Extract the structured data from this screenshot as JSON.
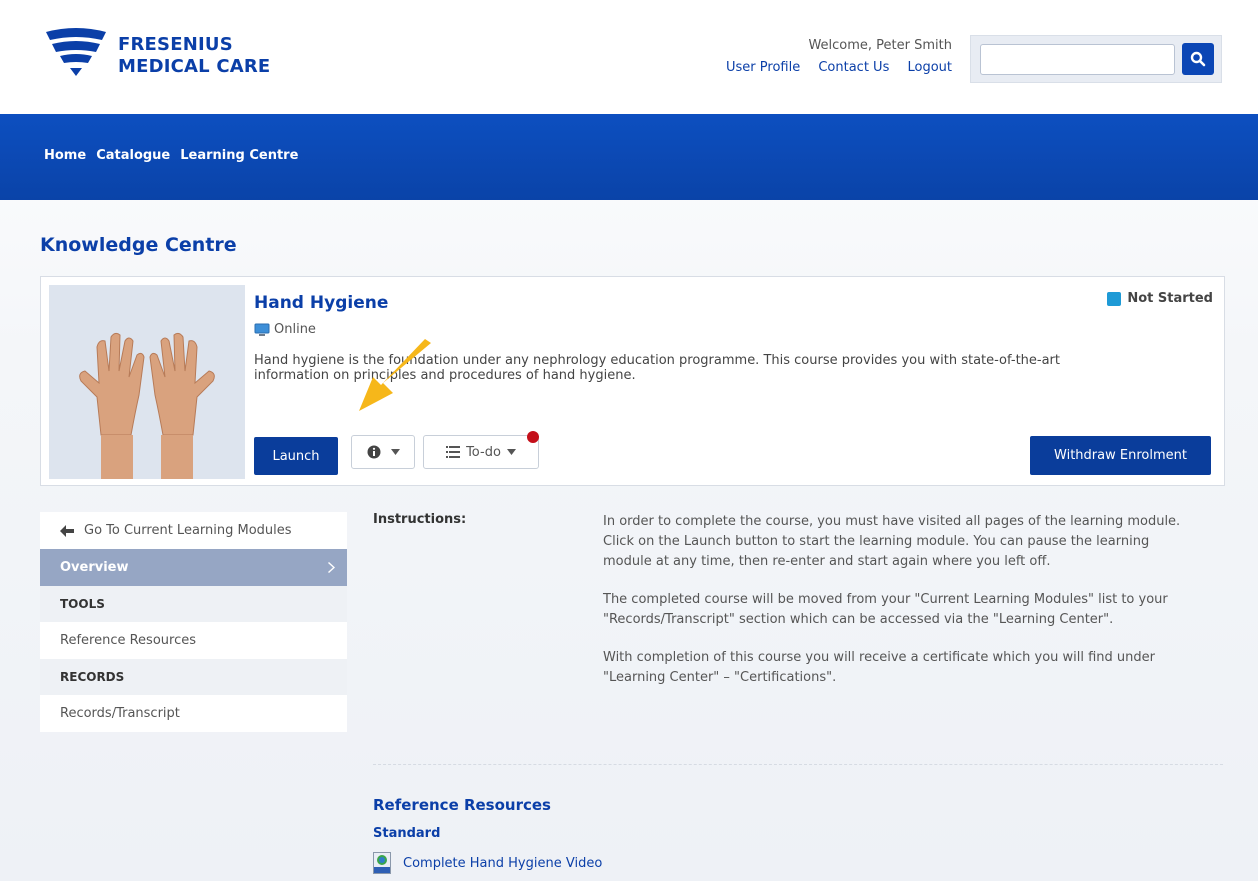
{
  "brand": {
    "line1": "FRESENIUS",
    "line2": "MEDICAL CARE",
    "color": "#0b3fa8"
  },
  "header": {
    "welcome": "Welcome, Peter Smith",
    "links": [
      "User Profile",
      "Contact Us",
      "Logout"
    ],
    "search": {
      "value": "",
      "placeholder": "",
      "button_icon": "search-icon"
    }
  },
  "nav": {
    "items": [
      "Home",
      "Catalogue",
      "Learning Centre"
    ],
    "bg_color": "#0d4fc0"
  },
  "page": {
    "title": "Knowledge Centre"
  },
  "course": {
    "title": "Hand Hygiene",
    "delivery": "Online",
    "description": "Hand hygiene is the foundation under any nephrology education programme. This course provides you with state-of-the-art information on principles and procedures of hand hygiene.",
    "status": "Not Started",
    "status_color": "#1e9ad6",
    "launch_label": "Launch",
    "info_icon": "info-icon",
    "todo_label": "To-do",
    "withdraw_label": "Withdraw Enrolment"
  },
  "sidebar": {
    "back_label": "Go To Current Learning Modules",
    "overview": "Overview",
    "tools_heading": "TOOLS",
    "reference_resources": "Reference Resources",
    "records_heading": "RECORDS",
    "records_transcript": "Records/Transcript"
  },
  "content": {
    "instructions_label": "Instructions:",
    "paragraphs": [
      "In order to complete the course, you must have visited all pages of the learning module. Click on the Launch button to start the learning module. You can pause the learning module at any time, then re-enter and start again where you left off.",
      "The completed course will be moved from your \"Current Learning Modules\" list to your \"Records/Transcript\" section which can be accessed via the \"Learning Center\".",
      "With completion of this course you will receive a certificate which you will find under \"Learning Center\" – \"Certifications\"."
    ],
    "ref_title": "Reference Resources",
    "ref_subtitle": "Standard",
    "ref_link": "Complete Hand Hygiene Video"
  }
}
